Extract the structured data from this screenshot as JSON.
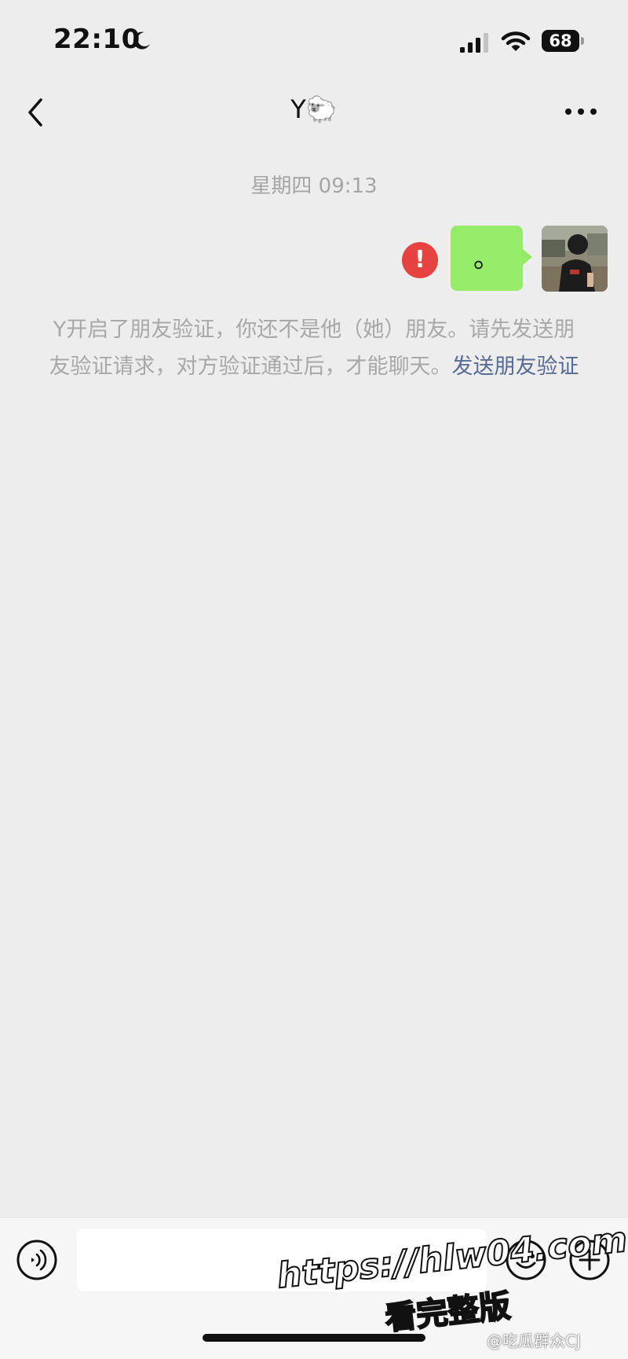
{
  "status_bar": {
    "time": "22:10",
    "battery": "68",
    "icons": [
      "moon-icon",
      "signal-icon",
      "wifi-icon",
      "battery-icon"
    ]
  },
  "nav": {
    "title": "Y🐑",
    "back_icon": "chevron-left-icon",
    "more_icon": "more-dots-icon"
  },
  "chat": {
    "timestamp": "星期四 09:13",
    "messages": [
      {
        "sender": "me",
        "text": "。",
        "status": "failed",
        "status_icon": "error-icon",
        "status_glyph": "!"
      }
    ],
    "system_notice": {
      "text": "Y开启了朋友验证，你还不是他（她）朋友。请先发送朋友验证请求，对方验证通过后，才能聊天。",
      "link": "发送朋友验证"
    }
  },
  "input_bar": {
    "value": "",
    "icons": [
      "voice-icon",
      "emoji-icon",
      "plus-icon"
    ]
  },
  "watermark": {
    "url": "https://hlw04.com",
    "subtitle": "看完整版",
    "source": "@吃瓜群众CJ"
  },
  "colors": {
    "background": "#ededed",
    "bubble": "#95ec69",
    "error": "#e64340",
    "link": "#576b95",
    "system_text": "#a8a8a8"
  }
}
